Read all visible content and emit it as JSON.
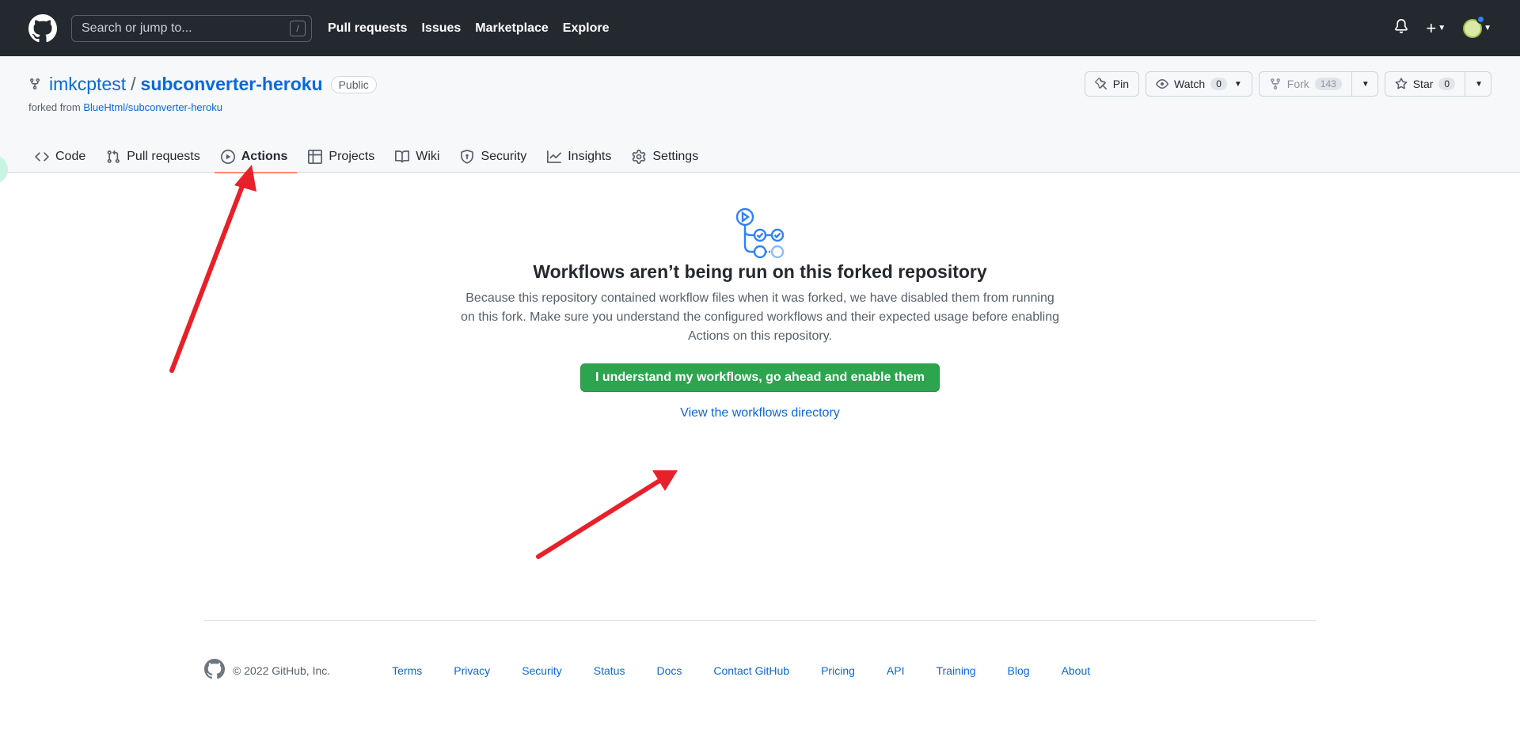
{
  "header": {
    "search_placeholder": "Search or jump to...",
    "search_shortcut": "/",
    "nav": [
      "Pull requests",
      "Issues",
      "Marketplace",
      "Explore"
    ]
  },
  "repo": {
    "owner": "imkcptest",
    "separator": "/",
    "name": "subconverter-heroku",
    "visibility": "Public",
    "forked_prefix": "forked from",
    "forked_from": "BlueHtml/subconverter-heroku",
    "pin_label": "Pin",
    "watch_label": "Watch",
    "watch_count": "0",
    "fork_label": "Fork",
    "fork_count": "143",
    "star_label": "Star",
    "star_count": "0"
  },
  "tabs": [
    {
      "label": "Code",
      "icon": "code-icon"
    },
    {
      "label": "Pull requests",
      "icon": "pull-request-icon"
    },
    {
      "label": "Actions",
      "icon": "play-icon",
      "active": true
    },
    {
      "label": "Projects",
      "icon": "table-icon"
    },
    {
      "label": "Wiki",
      "icon": "book-icon"
    },
    {
      "label": "Security",
      "icon": "shield-icon"
    },
    {
      "label": "Insights",
      "icon": "graph-icon"
    },
    {
      "label": "Settings",
      "icon": "gear-icon"
    }
  ],
  "main": {
    "title": "Workflows aren’t being run on this forked repository",
    "description": "Because this repository contained workflow files when it was forked, we have disabled them from running on this fork. Make sure you understand the configured workflows and their expected usage before enabling Actions on this repository.",
    "enable_button": "I understand my workflows, go ahead and enable them",
    "directory_link": "View the workflows directory"
  },
  "footer": {
    "copyright": "© 2022 GitHub, Inc.",
    "links": [
      "Terms",
      "Privacy",
      "Security",
      "Status",
      "Docs",
      "Contact GitHub",
      "Pricing",
      "API",
      "Training",
      "Blog",
      "About"
    ]
  },
  "colors": {
    "header_bg": "#24292f",
    "link": "#0969da",
    "primary_button": "#2da44e",
    "active_tab_underline": "#fd8c73",
    "annotation_arrow": "#e8202a"
  }
}
